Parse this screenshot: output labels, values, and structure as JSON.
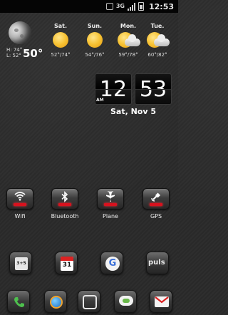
{
  "status_bar": {
    "network": "3G",
    "time": "12:53",
    "icons": [
      "vibrate-icon",
      "signal-icon",
      "battery-icon"
    ]
  },
  "weather": {
    "high": "H: 74°",
    "low": "L: 52°",
    "current_temp": "50°",
    "forecast": [
      {
        "day": "Sat.",
        "range": "52°/74°",
        "icon": "sunny"
      },
      {
        "day": "Sun.",
        "range": "54°/76°",
        "icon": "sunny"
      },
      {
        "day": "Mon.",
        "range": "59°/78°",
        "icon": "partly-cloudy"
      },
      {
        "day": "Tue.",
        "range": "60°/82°",
        "icon": "partly-cloudy"
      }
    ]
  },
  "clock": {
    "hour": "12",
    "minute": "53",
    "ampm": "AM",
    "date": "Sat, Nov 5"
  },
  "toggles": [
    {
      "label": "Wifi",
      "icon": "wifi-icon",
      "state_color": "#d8121e"
    },
    {
      "label": "Bluetooth",
      "icon": "bluetooth-icon",
      "state_color": "#d8121e"
    },
    {
      "label": "Plane",
      "icon": "airplane-icon",
      "state_color": "#d8121e"
    },
    {
      "label": "GPS",
      "icon": "gps-icon",
      "state_color": "#d8121e"
    }
  ],
  "home_apps": [
    {
      "name": "calculator",
      "icon_text": "3+5"
    },
    {
      "name": "calendar",
      "icon_text": "31"
    },
    {
      "name": "google-search",
      "icon_text": "G"
    },
    {
      "name": "pulse",
      "icon_text": "puls"
    }
  ],
  "dock": [
    {
      "name": "phone"
    },
    {
      "name": "browser"
    },
    {
      "name": "app-drawer"
    },
    {
      "name": "messaging"
    },
    {
      "name": "gmail"
    }
  ]
}
